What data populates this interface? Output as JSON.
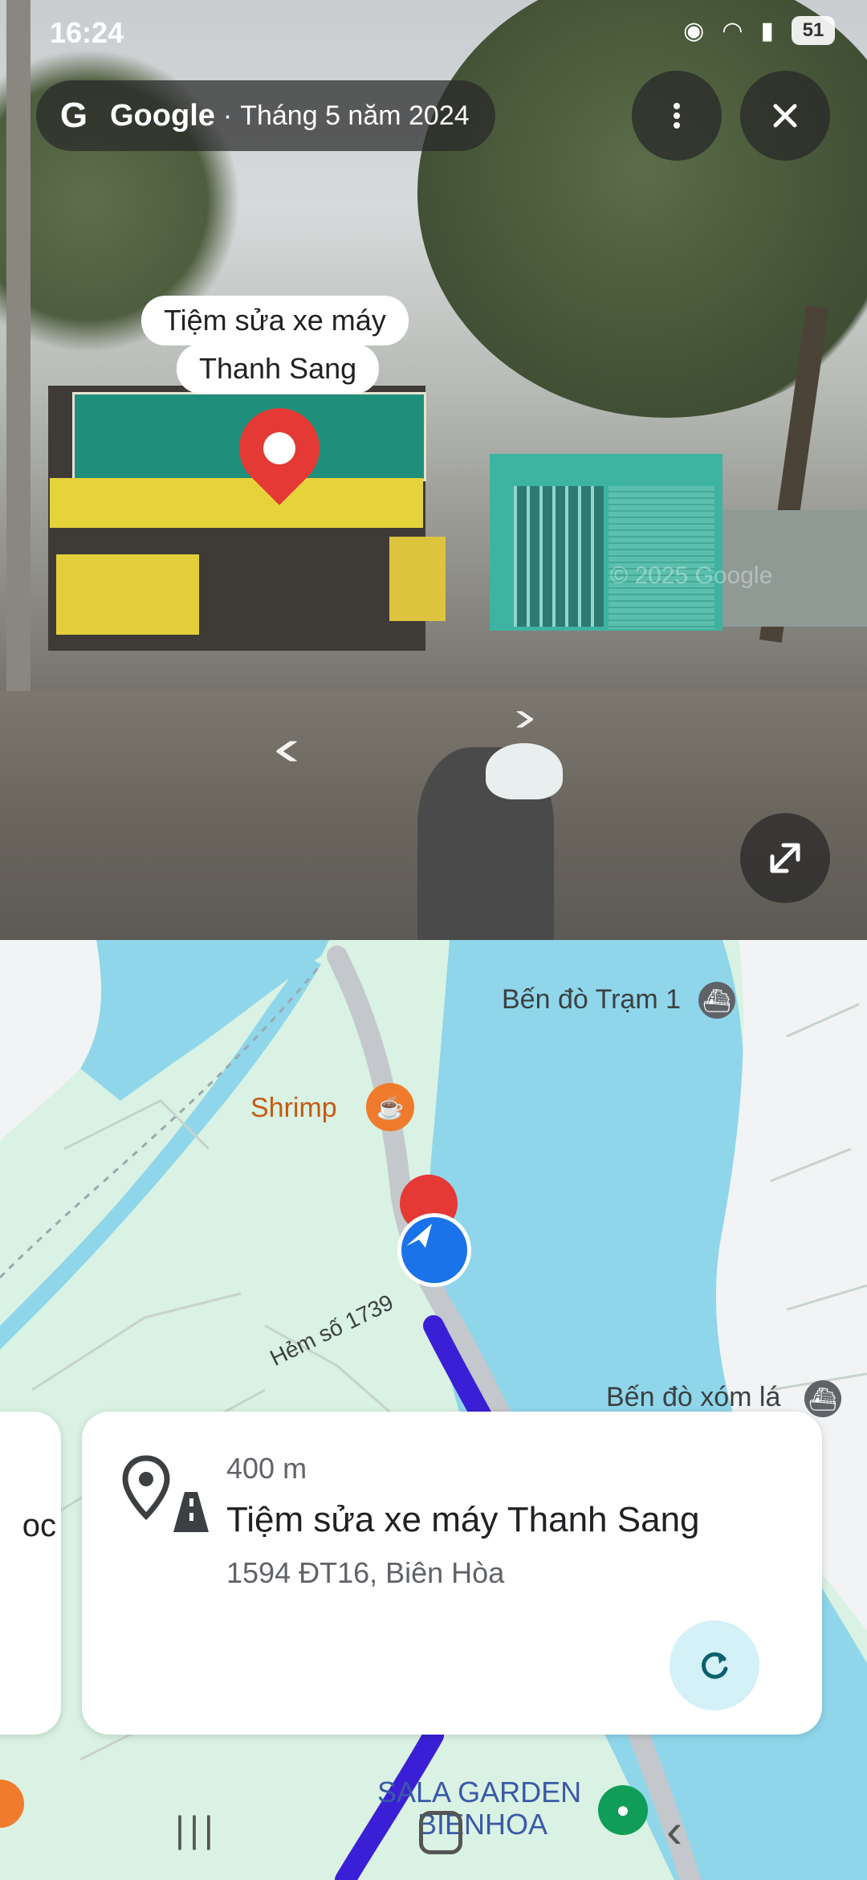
{
  "status_bar": {
    "time": "16:24",
    "battery": "51"
  },
  "header": {
    "brand": "Google",
    "separator": "·",
    "date": "Tháng 5 năm 2024"
  },
  "place_label": {
    "line1": "Tiệm sửa xe máy",
    "line2": "Thanh Sang"
  },
  "watermark": "© 2025 Google",
  "map": {
    "labels": {
      "ferry1": "Bến đò Trạm 1",
      "shrimp": "Shrimp",
      "alley": "Hẻm số 1739",
      "ferry2": "Bến đò xóm lá",
      "sala1": "SALA GARDEN",
      "sala2": "BIENHOA"
    }
  },
  "card": {
    "distance": "400 m",
    "title": "Tiệm sửa xe máy Thanh Sang",
    "address": "1594 ĐT16, Biên Hòa",
    "prev_fragment": "oc"
  },
  "icons": {
    "more": "more-vert-icon",
    "close": "close-icon",
    "expand": "expand-icon",
    "refresh": "refresh-icon",
    "place": "place-road-icon"
  },
  "colors": {
    "route": "#3b1fd6",
    "water": "#8fd6ea",
    "land": "#d9f2e3",
    "pin": "#e53935",
    "nav_arrow": "#1a73e8"
  }
}
